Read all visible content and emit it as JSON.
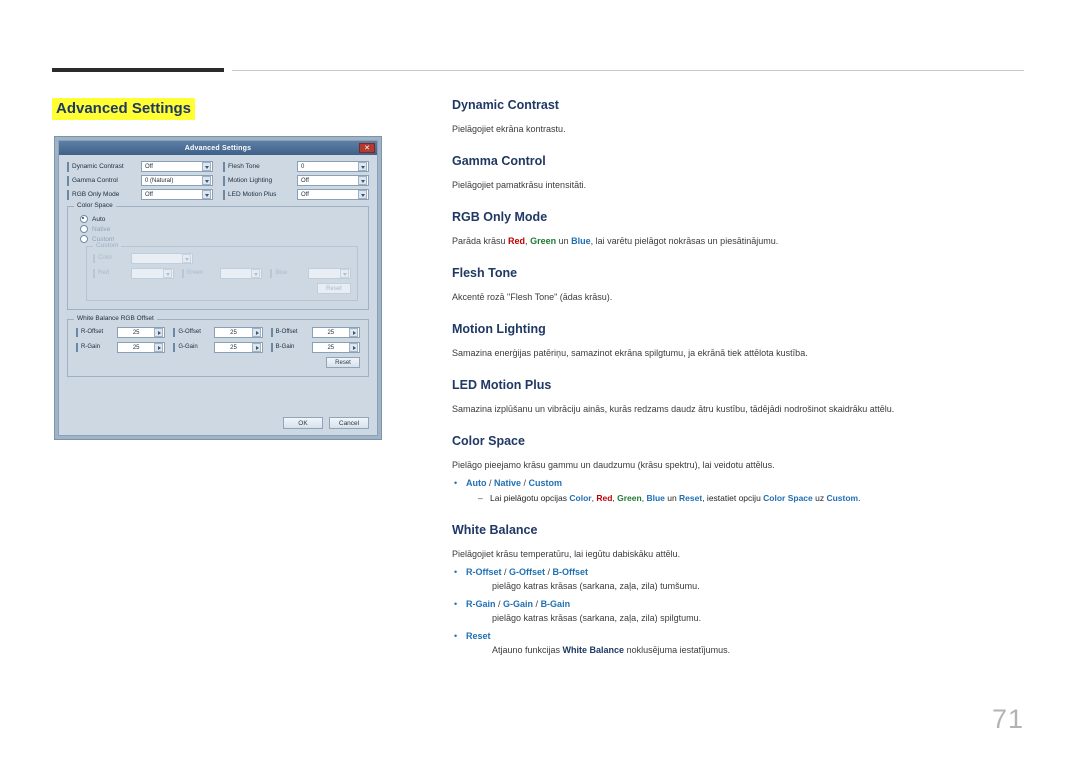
{
  "page": {
    "title": "Advanced Settings",
    "number": "71"
  },
  "dialog": {
    "title": "Advanced Settings",
    "close_label": "✕",
    "fields": {
      "dynamic_contrast": {
        "label": "Dynamic Contrast",
        "value": "Off"
      },
      "gamma_control": {
        "label": "Gamma Control",
        "value": "0 (Natural)"
      },
      "rgb_only_mode": {
        "label": "RGB Only Mode",
        "value": "Off"
      },
      "flesh_tone": {
        "label": "Flesh Tone",
        "value": "0"
      },
      "motion_lighting": {
        "label": "Motion Lighting",
        "value": "Off"
      },
      "led_motion_plus": {
        "label": "LED Motion Plus",
        "value": "Off"
      }
    },
    "color_space": {
      "group_label": "Color Space",
      "options": [
        "Auto",
        "Native",
        "Custom"
      ],
      "selected": "Auto",
      "custom_group_label": "Custom",
      "custom_fields": [
        {
          "label": "Color",
          "value": ""
        },
        {
          "label": "Red",
          "value": ""
        },
        {
          "label": "Green",
          "value": ""
        },
        {
          "label": "Blue",
          "value": ""
        }
      ],
      "reset_label": "Reset"
    },
    "white_balance": {
      "group_label": "White Balance RGB Offset",
      "fields": [
        {
          "label": "R-Offset",
          "value": "25"
        },
        {
          "label": "G-Offset",
          "value": "25"
        },
        {
          "label": "B-Offset",
          "value": "25"
        },
        {
          "label": "R-Gain",
          "value": "25"
        },
        {
          "label": "G-Gain",
          "value": "25"
        },
        {
          "label": "B-Gain",
          "value": "25"
        }
      ],
      "reset_label": "Reset"
    },
    "ok_label": "OK",
    "cancel_label": "Cancel"
  },
  "sections": {
    "dynamic_contrast": {
      "heading": "Dynamic Contrast",
      "body": "Pielāgojiet ekrāna kontrastu."
    },
    "gamma_control": {
      "heading": "Gamma Control",
      "body": "Pielāgojiet pamatkrāsu intensitāti."
    },
    "rgb_only_mode": {
      "heading": "RGB Only Mode",
      "body_pre": "Parāda krāsu ",
      "kw_red": "Red",
      "kw_green": "Green",
      "kw_un": " un ",
      "kw_blue": "Blue",
      "body_post": ", lai varētu pielāgot nokrāsas un piesātinājumu."
    },
    "flesh_tone": {
      "heading": "Flesh Tone",
      "body": "Akcentē rozā \"Flesh Tone\" (ādas krāsu)."
    },
    "motion_lighting": {
      "heading": "Motion Lighting",
      "body": "Samazina enerģijas patēriņu, samazinot ekrāna spilgtumu, ja ekrānā tiek attēlota kustība."
    },
    "led_motion_plus": {
      "heading": "LED Motion Plus",
      "body": "Samazina izplūšanu un vibrāciju ainās, kurās redzams daudz ātru kustību, tādējādi nodrošinot skaidrāku attēlu."
    },
    "color_space": {
      "heading": "Color Space",
      "body": "Pielāgo pieejamo krāsu gammu un daudzumu (krāsu spektru), lai veidotu attēlus.",
      "bullet_marker": "•",
      "bullet_auto": "Auto",
      "bullet_native": "Native",
      "bullet_custom": "Custom",
      "sep1": " / ",
      "sep2": " / ",
      "sub_marker": "–",
      "sub_pre": "Lai pielāgotu opcijas ",
      "sub_color": "Color",
      "sub_c1": ", ",
      "sub_red": "Red",
      "sub_c2": ", ",
      "sub_green": "Green",
      "sub_c3": ", ",
      "sub_blue": "Blue",
      "sub_un": " un ",
      "sub_reset": "Reset",
      "sub_mid": ", iestatiet opciju ",
      "sub_colorspace": "Color Space",
      "sub_uz": " uz ",
      "sub_custom": "Custom",
      "sub_end": "."
    },
    "white_balance": {
      "heading": "White Balance",
      "body": "Pielāgojiet krāsu temperatūru, lai iegūtu dabiskāku attēlu.",
      "bullet_marker": "•",
      "b1_roffset": "R-Offset",
      "b1_goffset": "G-Offset",
      "b1_boffset": "B-Offset",
      "b1_desc": "pielāgo katras krāsas (sarkana, zaļa, zila) tumšumu.",
      "b2_rgain": "R-Gain",
      "b2_ggain": "G-Gain",
      "b2_bgain": "B-Gain",
      "b2_desc": "pielāgo katras krāsas (sarkana, zaļa, zila) spilgtumu.",
      "b3_reset": "Reset",
      "b3_pre": "Atjauno funkcijas ",
      "b3_kw": "White Balance",
      "b3_post": " noklusējuma iestatījumus.",
      "sep": " / "
    }
  }
}
